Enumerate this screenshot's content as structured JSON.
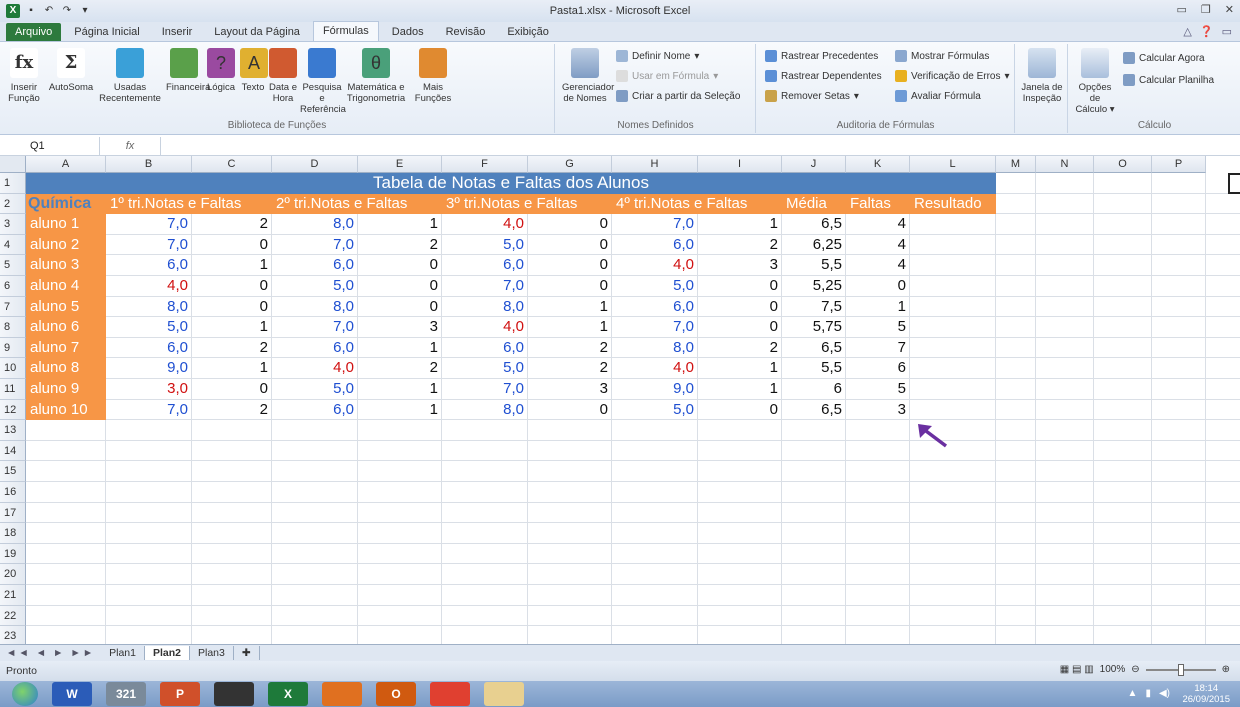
{
  "window": {
    "title": "Pasta1.xlsx - Microsoft Excel"
  },
  "tabs": [
    "Arquivo",
    "Página Inicial",
    "Inserir",
    "Layout da Página",
    "Fórmulas",
    "Dados",
    "Revisão",
    "Exibição"
  ],
  "active_tab": "Fórmulas",
  "ribbon": {
    "biblioteca": {
      "group_label": "Biblioteca de Funções",
      "buttons": [
        "Inserir Função",
        "AutoSoma",
        "Usadas Recentemente",
        "Financeira",
        "Lógica",
        "Texto",
        "Data e Hora",
        "Pesquisa e Referência",
        "Matemática e Trigonometria",
        "Mais Funções"
      ]
    },
    "nomes": {
      "group_label": "Nomes Definidos",
      "gerenciador": "Gerenciador de Nomes",
      "definir": "Definir Nome",
      "usar": "Usar em Fórmula",
      "criar": "Criar a partir da Seleção"
    },
    "auditoria": {
      "group_label": "Auditoria de Fórmulas",
      "precedentes": "Rastrear Precedentes",
      "dependentes": "Rastrear Dependentes",
      "remover": "Remover Setas",
      "mostrar": "Mostrar Fórmulas",
      "verificacao": "Verificação de Erros",
      "avaliar": "Avaliar Fórmula",
      "janela": "Janela de Inspeção"
    },
    "calculo": {
      "group_label": "Cálculo",
      "opcoes": "Opções de Cálculo",
      "agora": "Calcular Agora",
      "planilha": "Calcular Planilha"
    }
  },
  "formula_bar": {
    "name_box": "Q1",
    "fx": "fx",
    "content": ""
  },
  "columns": [
    "A",
    "B",
    "C",
    "D",
    "E",
    "F",
    "G",
    "H",
    "I",
    "J",
    "K",
    "L",
    "M",
    "N",
    "O",
    "P"
  ],
  "rows": [
    "1",
    "2",
    "3",
    "4",
    "5",
    "6",
    "7",
    "8",
    "9",
    "10",
    "11",
    "12",
    "13",
    "14",
    "15",
    "16",
    "17",
    "18",
    "19",
    "20",
    "21",
    "22",
    "23"
  ],
  "sheet": {
    "banner": "Tabela de Notas e Faltas dos Alunos",
    "subject": "Química",
    "headers": [
      "1º tri.Notas e Faltas",
      "2º tri.Notas e Faltas",
      "3º tri.Notas e Faltas",
      "4º tri.Notas e Faltas",
      "Média",
      "Faltas",
      "Resultado"
    ],
    "students": [
      {
        "name": "aluno 1",
        "n1": "7,0",
        "f1": "2",
        "n2": "8,0",
        "f2": "1",
        "n3": "4,0",
        "f3": "0",
        "n4": "7,0",
        "f4": "1",
        "media": "6,5",
        "faltas": "4"
      },
      {
        "name": "aluno 2",
        "n1": "7,0",
        "f1": "0",
        "n2": "7,0",
        "f2": "2",
        "n3": "5,0",
        "f3": "0",
        "n4": "6,0",
        "f4": "2",
        "media": "6,25",
        "faltas": "4"
      },
      {
        "name": "aluno 3",
        "n1": "6,0",
        "f1": "1",
        "n2": "6,0",
        "f2": "0",
        "n3": "6,0",
        "f3": "0",
        "n4": "4,0",
        "f4": "3",
        "media": "5,5",
        "faltas": "4"
      },
      {
        "name": "aluno 4",
        "n1": "4,0",
        "f1": "0",
        "n2": "5,0",
        "f2": "0",
        "n3": "7,0",
        "f3": "0",
        "n4": "5,0",
        "f4": "0",
        "media": "5,25",
        "faltas": "0"
      },
      {
        "name": "aluno 5",
        "n1": "8,0",
        "f1": "0",
        "n2": "8,0",
        "f2": "0",
        "n3": "8,0",
        "f3": "1",
        "n4": "6,0",
        "f4": "0",
        "media": "7,5",
        "faltas": "1"
      },
      {
        "name": "aluno 6",
        "n1": "5,0",
        "f1": "1",
        "n2": "7,0",
        "f2": "3",
        "n3": "4,0",
        "f3": "1",
        "n4": "7,0",
        "f4": "0",
        "media": "5,75",
        "faltas": "5"
      },
      {
        "name": "aluno 7",
        "n1": "6,0",
        "f1": "2",
        "n2": "6,0",
        "f2": "1",
        "n3": "6,0",
        "f3": "2",
        "n4": "8,0",
        "f4": "2",
        "media": "6,5",
        "faltas": "7"
      },
      {
        "name": "aluno 8",
        "n1": "9,0",
        "f1": "1",
        "n2": "4,0",
        "f2": "2",
        "n3": "5,0",
        "f3": "2",
        "n4": "4,0",
        "f4": "1",
        "media": "5,5",
        "faltas": "6"
      },
      {
        "name": "aluno 9",
        "n1": "3,0",
        "f1": "0",
        "n2": "5,0",
        "f2": "1",
        "n3": "7,0",
        "f3": "3",
        "n4": "9,0",
        "f4": "1",
        "media": "6",
        "faltas": "5"
      },
      {
        "name": "aluno 10",
        "n1": "7,0",
        "f1": "2",
        "n2": "6,0",
        "f2": "1",
        "n3": "8,0",
        "f3": "0",
        "n4": "5,0",
        "f4": "0",
        "media": "6,5",
        "faltas": "3"
      }
    ],
    "pass_grade_threshold": 5,
    "colors": {
      "banner": "#4f81bd",
      "header": "#f79646",
      "grade_ok": "#1f4fd1",
      "grade_low": "#d01010",
      "arrow": "#6a2fa0"
    }
  },
  "sheet_tabs": [
    "Plan1",
    "Plan2",
    "Plan3"
  ],
  "active_sheet": "Plan2",
  "status": {
    "ready": "Pronto",
    "zoom": "100%"
  },
  "taskbar": {
    "apps": [
      "W",
      "321",
      "P",
      "",
      "X",
      "",
      "O",
      "",
      ""
    ],
    "time": "18:14",
    "date": "26/09/2015"
  }
}
